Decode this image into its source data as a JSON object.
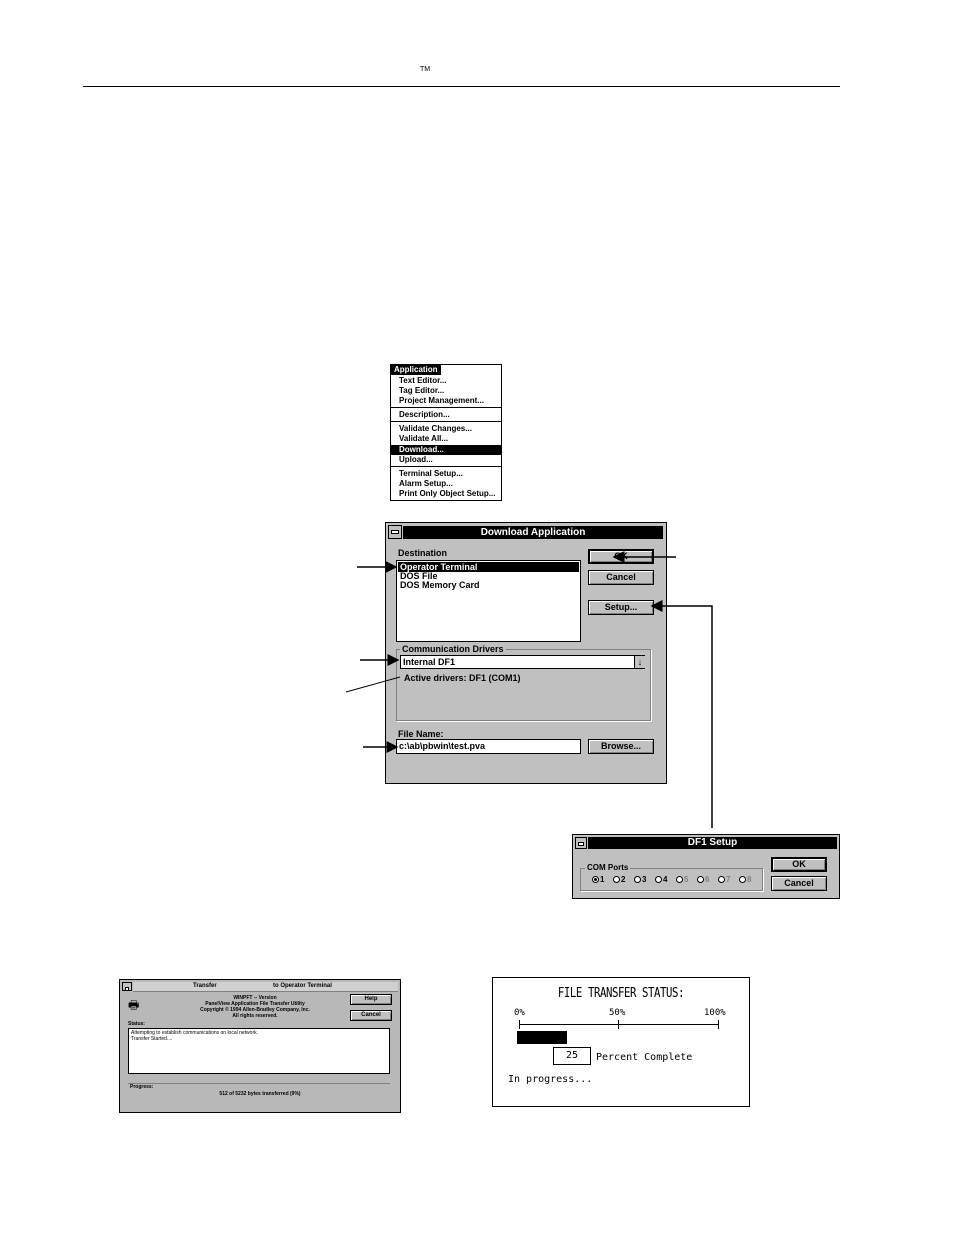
{
  "header": {
    "trademark": "TM"
  },
  "app_menu": {
    "title": "Application",
    "items": [
      {
        "label": "Text Editor..."
      },
      {
        "label": "Tag Editor..."
      },
      {
        "label": "Project Management..."
      },
      {
        "label": "Description..."
      },
      {
        "label": "Validate Changes..."
      },
      {
        "label": "Validate All..."
      },
      {
        "label": "Download..."
      },
      {
        "label": "Upload..."
      },
      {
        "label": "Terminal Setup..."
      },
      {
        "label": "Alarm Setup..."
      },
      {
        "label": "Print Only Object Setup..."
      }
    ],
    "selected": "Download..."
  },
  "download_dialog": {
    "title": "Download Application",
    "destination_label": "Destination",
    "destinations": [
      "Operator Terminal",
      "DOS File",
      "DOS Memory Card"
    ],
    "ok": "OK",
    "cancel": "Cancel",
    "setup": "Setup...",
    "comm_label": "Communication Drivers",
    "driver_value": "Internal DF1",
    "active_drivers": "Active drivers: DF1 (COM1)",
    "file_label": "File Name:",
    "file_value": "c:\\ab\\pbwin\\test.pva",
    "browse": "Browse..."
  },
  "df1_dialog": {
    "title": "DF1 Setup",
    "com_ports_label": "COM Ports",
    "ports": [
      "1",
      "2",
      "3",
      "4",
      "5",
      "6",
      "7",
      "8"
    ],
    "selected_port": "1",
    "ok": "OK",
    "cancel": "Cancel"
  },
  "transfer_dialog": {
    "title_left": "Transfer",
    "title_right": "to Operator Terminal",
    "line1": "WINPFT  --  Version",
    "line2": "PanelView Application File Transfer Utility",
    "line3": "Copyright © 1994 Allen-Bradley Company, Inc.",
    "line4": "All rights reserved.",
    "help": "Help",
    "cancel": "Cancel",
    "status_label": "Status:",
    "status_lines": [
      "Attempting to establish communications on local network.",
      "Transfer Started...."
    ],
    "progress_label": "Progress:",
    "progress_text": "512 of 5232 bytes transferred  (9%)"
  },
  "terminal_status": {
    "title": "FILE TRANSFER STATUS:",
    "tick_0": "0%",
    "tick_50": "50%",
    "tick_100": "100%",
    "percent_value": 25,
    "percent_text": "25",
    "percent_label": "Percent Complete",
    "status": "In progress..."
  }
}
